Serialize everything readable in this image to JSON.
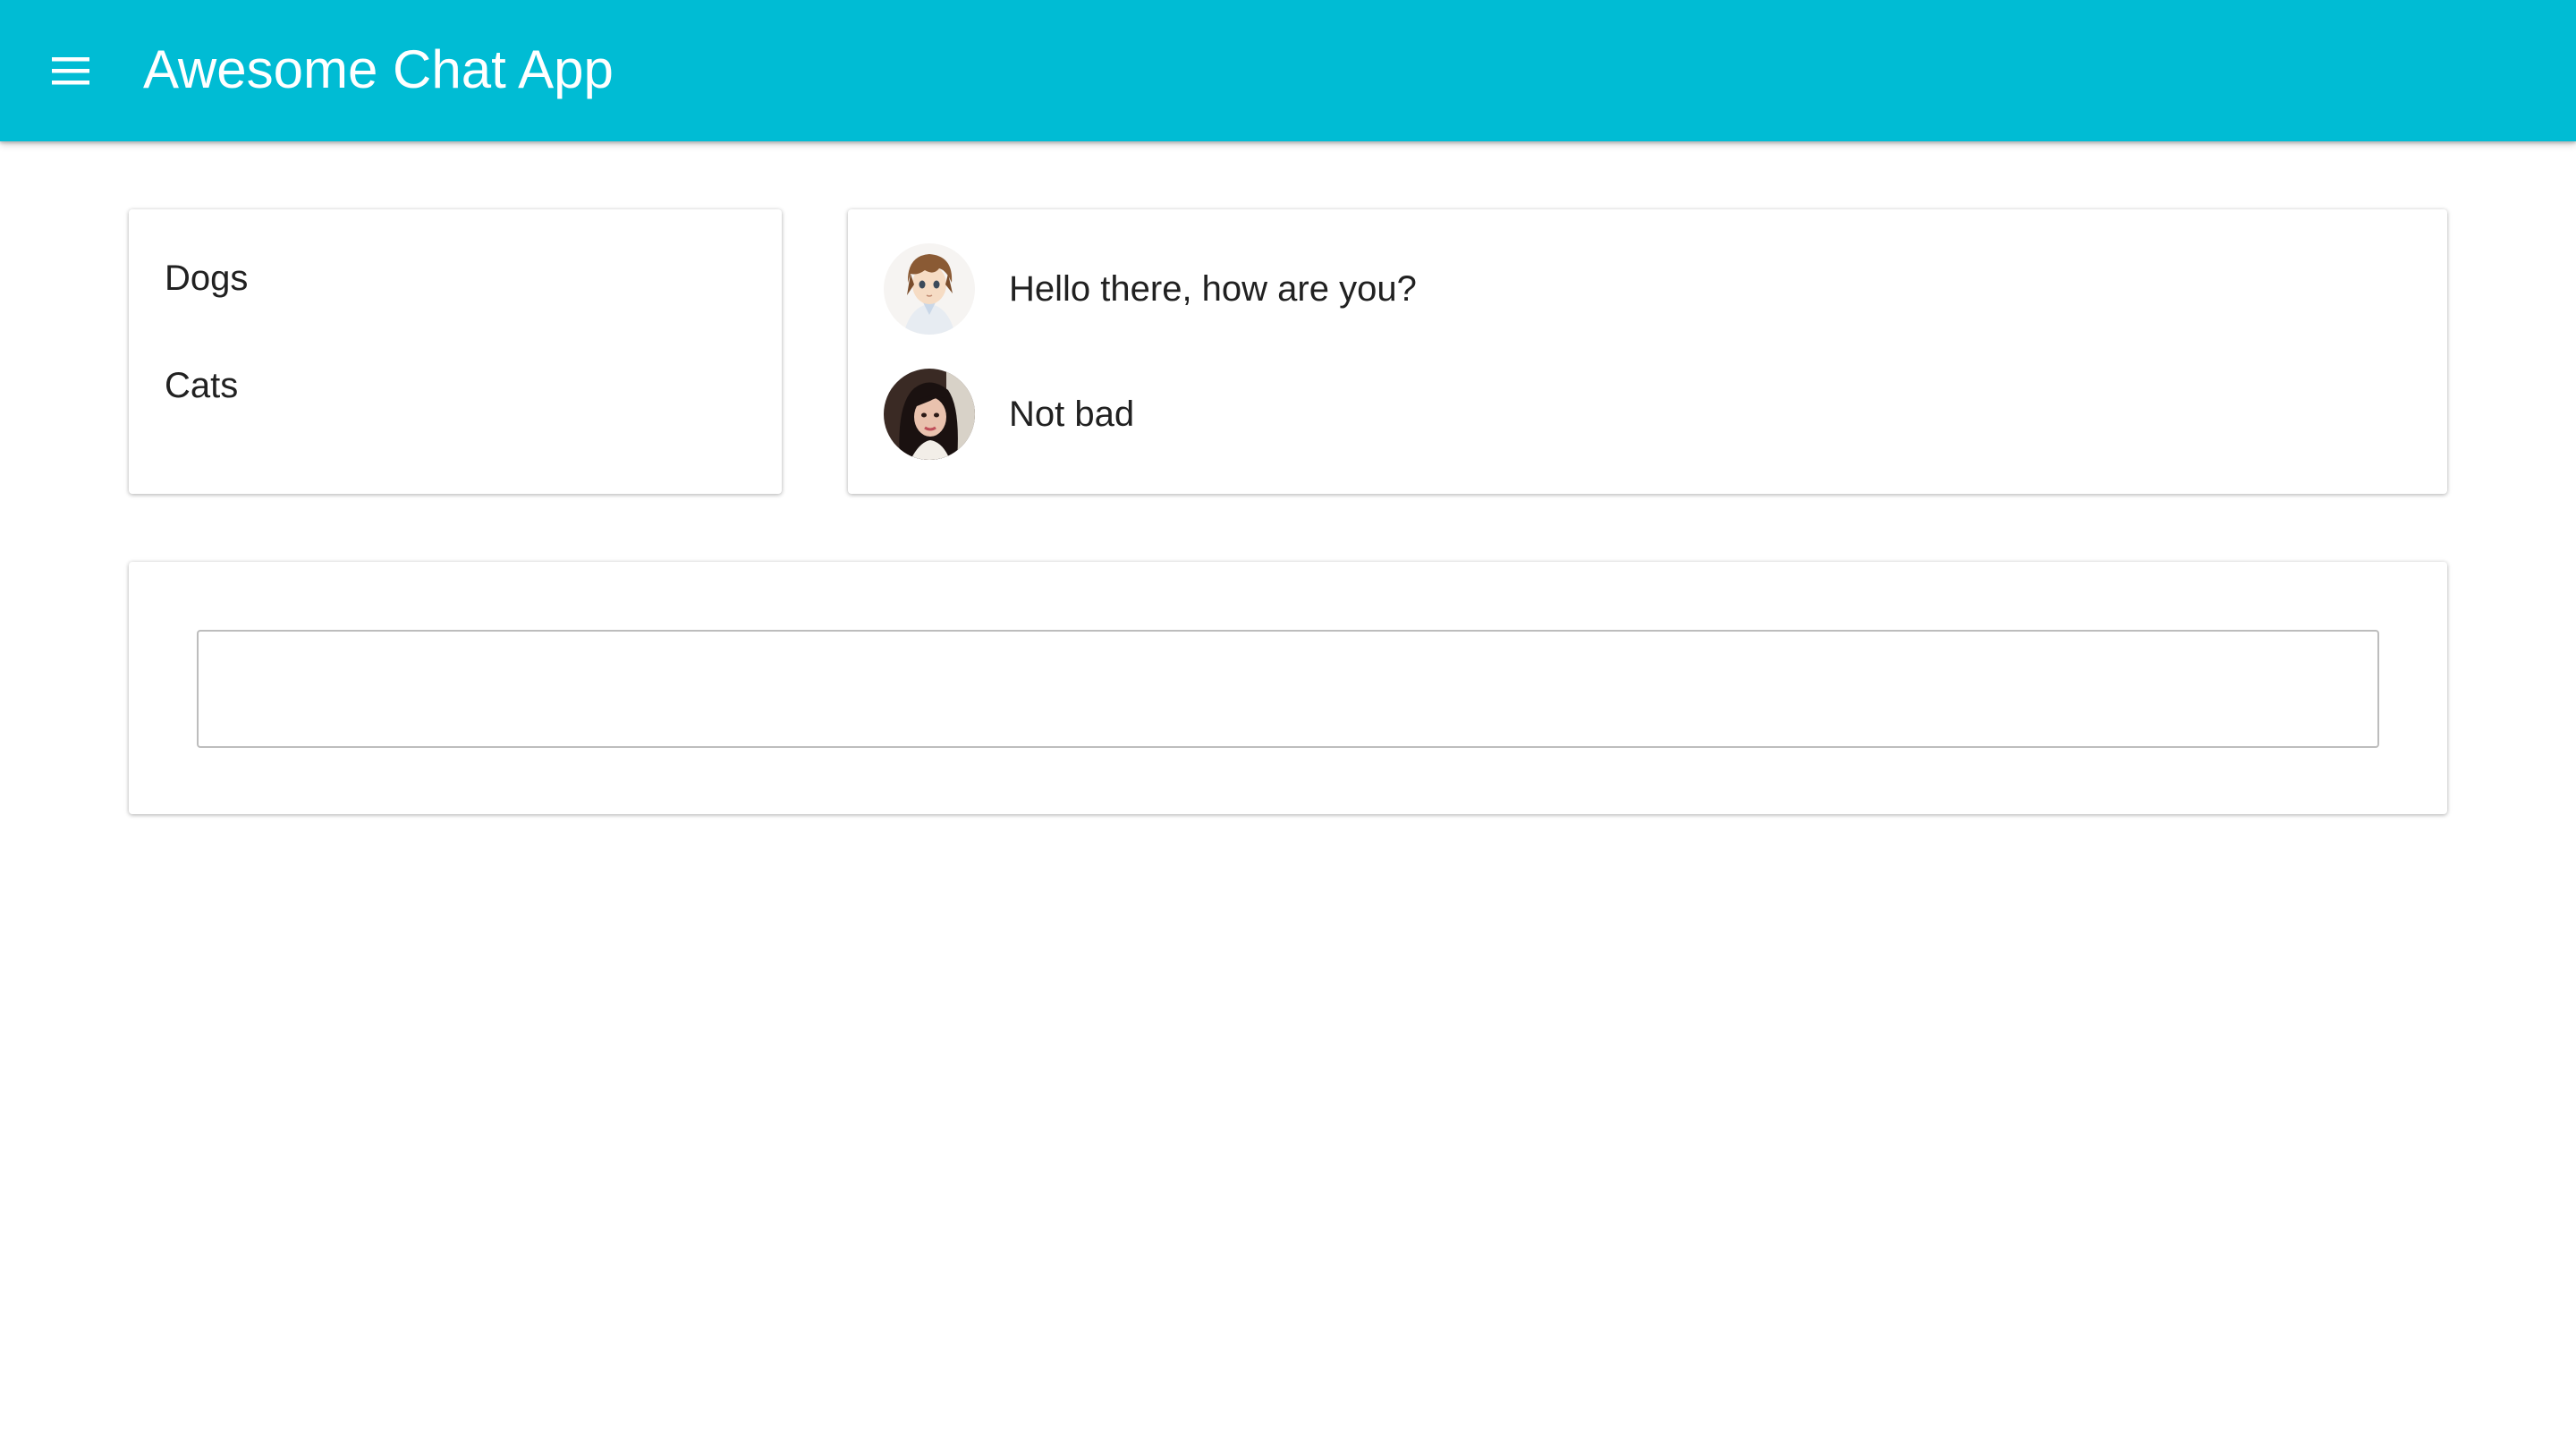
{
  "appbar": {
    "title": "Awesome Chat App",
    "menu_icon": "menu-icon",
    "color": "#00bcd4"
  },
  "channels": {
    "items": [
      {
        "label": "Dogs"
      },
      {
        "label": "Cats"
      }
    ]
  },
  "messages": [
    {
      "avatar": "anime-boy-avatar",
      "text": "Hello there, how are you?"
    },
    {
      "avatar": "woman-avatar",
      "text": "Not bad"
    }
  ],
  "compose": {
    "value": "",
    "placeholder": ""
  }
}
